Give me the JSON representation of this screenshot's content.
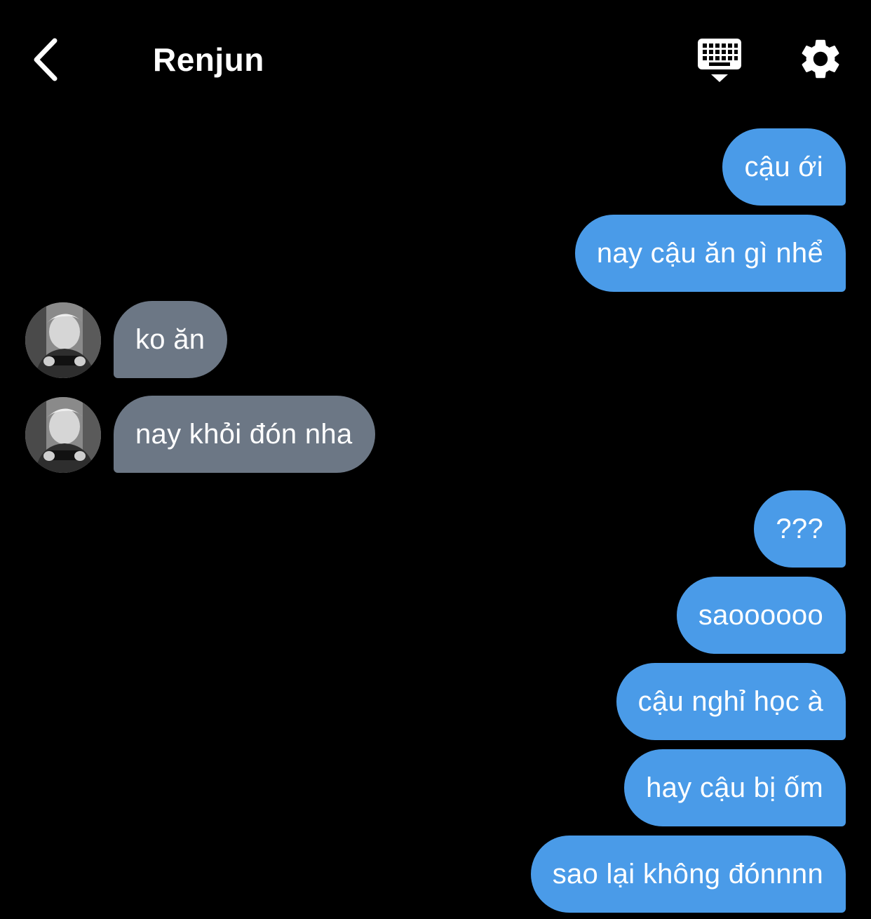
{
  "header": {
    "back_icon": "chevron-left-icon",
    "title": "Renjun",
    "keyboard_icon": "keyboard-icon",
    "settings_icon": "gear-icon"
  },
  "colors": {
    "background": "#000000",
    "outgoing_bubble": "#4a9be8",
    "incoming_bubble": "#6c7785",
    "text": "#ffffff"
  },
  "messages": [
    {
      "sender": "me",
      "text": "cậu ới"
    },
    {
      "sender": "me",
      "text": "nay cậu ăn gì nhể"
    },
    {
      "sender": "Renjun",
      "text": "ko ăn"
    },
    {
      "sender": "Renjun",
      "text": "nay khỏi đón nha"
    },
    {
      "sender": "me",
      "text": "???"
    },
    {
      "sender": "me",
      "text": "saoooooo"
    },
    {
      "sender": "me",
      "text": "cậu nghỉ học à"
    },
    {
      "sender": "me",
      "text": "hay cậu bị ốm"
    },
    {
      "sender": "me",
      "text": "sao lại không đónnnn"
    }
  ]
}
